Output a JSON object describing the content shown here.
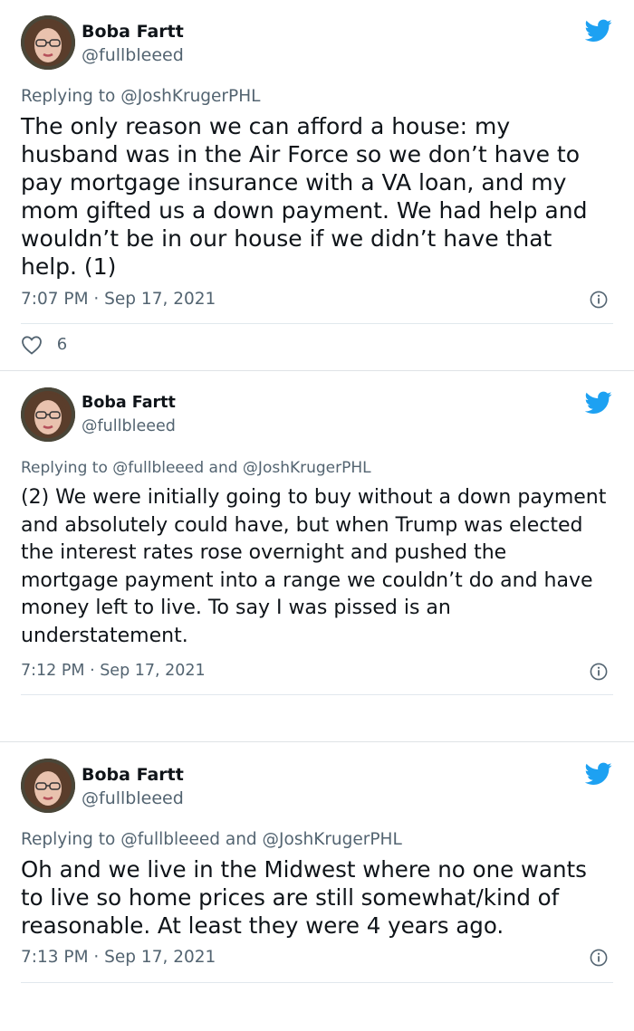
{
  "tweets": [
    {
      "name": "Boba Fartt",
      "handle": "@fullbleeed",
      "reply_prefix": "Replying to",
      "reply_to": "@JoshKrugerPHL",
      "text_lines": [
        "The only reason we can afford a house: my",
        "husband was in the Air Force so we don’t have to",
        "pay mortgage insurance with a VA loan, and my",
        "mom gifted us a down payment. We had help and",
        "wouldn’t be in our house if we didn’t have that",
        "help. (1)"
      ],
      "timestamp": "7:07 PM · Sep 17, 2021",
      "likes": "6"
    },
    {
      "name": "Boba Fartt",
      "handle": "@fullbleeed",
      "reply_prefix": "Replying to",
      "reply_to": "@fullbleeed and @JoshKrugerPHL",
      "text_lines": [
        "(2) We were initially going to buy without a down payment",
        "and absolutely could have, but when Trump was elected",
        "the interest rates rose overnight and pushed the",
        "mortgage payment into a range we couldn’t do and have",
        "money left to live. To say I was pissed is an",
        "understatement."
      ],
      "timestamp": "7:12 PM · Sep 17, 2021"
    },
    {
      "name": "Boba Fartt",
      "handle": "@fullbleeed",
      "reply_prefix": "Replying to",
      "reply_to": "@fullbleeed and @JoshKrugerPHL",
      "text_lines": [
        "Oh and we live in the Midwest where no one wants",
        "to live so home prices are still somewhat/kind of",
        "reasonable. At least they were 4 years ago."
      ],
      "timestamp": "7:13 PM · Sep 17, 2021"
    }
  ],
  "colors": {
    "bird": "#1da1f2",
    "muted": "#536471",
    "text": "#0f1419"
  },
  "icons": {
    "brand": "twitter-bird-icon",
    "info": "info-icon",
    "like": "heart-icon"
  }
}
